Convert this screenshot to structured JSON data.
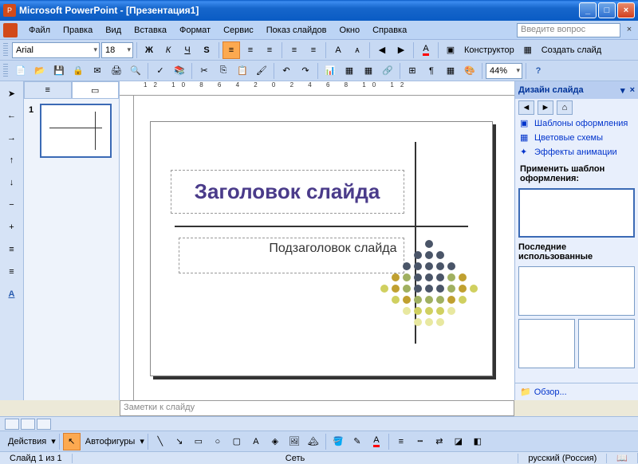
{
  "app": {
    "title": "Microsoft PowerPoint - [Презентация1]"
  },
  "menu": [
    "Файл",
    "Правка",
    "Вид",
    "Вставка",
    "Формат",
    "Сервис",
    "Показ слайдов",
    "Окно",
    "Справка"
  ],
  "ask": "Введите вопрос",
  "format": {
    "font": "Arial",
    "size": "18",
    "designer": "Конструктор",
    "newslide": "Создать слайд"
  },
  "zoom": "44%",
  "slide": {
    "title": "Заголовок слайда",
    "subtitle": "Подзаголовок слайда"
  },
  "thumbs": {
    "num": "1"
  },
  "notes": "Заметки к слайду",
  "drawbar": {
    "actions": "Действия",
    "autoshapes": "Автофигуры"
  },
  "status": {
    "slide": "Слайд 1 из 1",
    "mid": "Сеть",
    "lang": "русский (Россия)"
  },
  "taskpane": {
    "title": "Дизайн слайда",
    "links": [
      "Шаблоны оформления",
      "Цветовые схемы",
      "Эффекты анимации"
    ],
    "apply": "Применить шаблон оформления:",
    "recent": "Последние использованные",
    "browse": "Обзор..."
  }
}
